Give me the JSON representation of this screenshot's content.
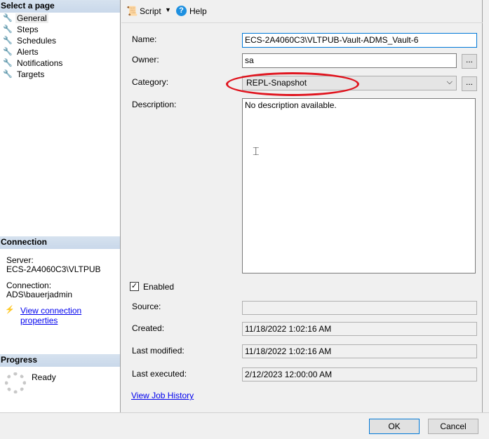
{
  "left": {
    "select_header": "Select a page",
    "pages": [
      {
        "label": "General",
        "selected": true
      },
      {
        "label": "Steps"
      },
      {
        "label": "Schedules"
      },
      {
        "label": "Alerts"
      },
      {
        "label": "Notifications"
      },
      {
        "label": "Targets"
      }
    ],
    "connection_header": "Connection",
    "server_label": "Server:",
    "server_value": "ECS-2A4060C3\\VLTPUB",
    "connection_label": "Connection:",
    "connection_value": "ADS\\bauerjadmin",
    "view_connection_link": "View connection properties",
    "progress_header": "Progress",
    "progress_status": "Ready"
  },
  "toolbar": {
    "script_label": "Script",
    "help_label": "Help"
  },
  "form": {
    "name_label": "Name:",
    "name_value": "ECS-2A4060C3\\VLTPUB-Vault-ADMS_Vault-6",
    "owner_label": "Owner:",
    "owner_value": "sa",
    "category_label": "Category:",
    "category_value": "REPL-Snapshot",
    "description_label": "Description:",
    "description_value": "No description available.",
    "enabled_label": "Enabled",
    "enabled": true,
    "source_label": "Source:",
    "source_value": "",
    "created_label": "Created:",
    "created_value": "11/18/2022 1:02:16 AM",
    "modified_label": "Last modified:",
    "modified_value": "11/18/2022 1:02:16 AM",
    "executed_label": "Last executed:",
    "executed_value": "2/12/2023 12:00:00 AM",
    "job_history_link": "View Job History",
    "browse_label": "..."
  },
  "footer": {
    "ok_label": "OK",
    "cancel_label": "Cancel"
  },
  "colors": {
    "highlight_ellipse": "#e0141e",
    "link": "#0000ee"
  }
}
